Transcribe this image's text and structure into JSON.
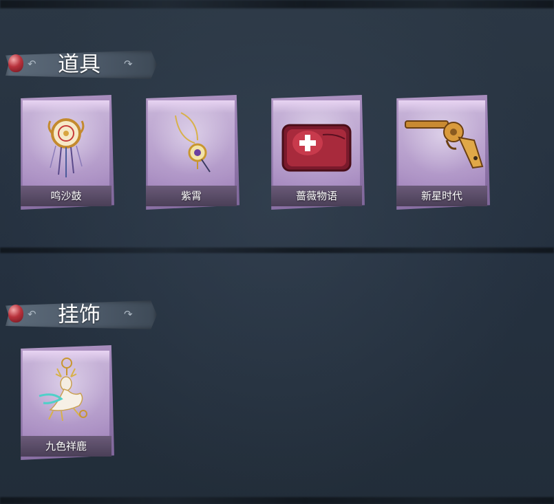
{
  "sections": [
    {
      "title": "道具",
      "items": [
        {
          "name": "鸣沙鼓",
          "icon": "dreamcatcher-drum-icon"
        },
        {
          "name": "紫霄",
          "icon": "pendant-necklace-icon"
        },
        {
          "name": "蔷薇物语",
          "icon": "first-aid-kit-icon"
        },
        {
          "name": "新星时代",
          "icon": "revolver-icon"
        }
      ]
    },
    {
      "title": "挂饰",
      "items": [
        {
          "name": "九色祥鹿",
          "icon": "deer-charm-icon"
        }
      ]
    }
  ]
}
